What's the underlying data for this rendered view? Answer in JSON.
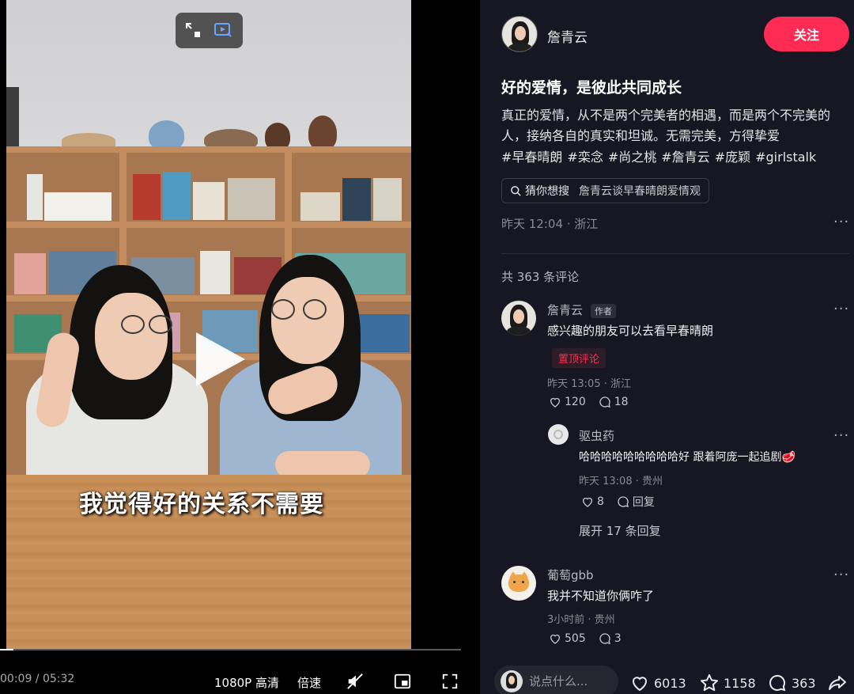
{
  "video": {
    "subtitle": "我觉得好的关系不需要",
    "time": "00:09 / 05:32",
    "progress": 0.03,
    "quality_label": "1080P 高清",
    "speed_label": "倍速"
  },
  "author": {
    "name": "詹青云",
    "follow_label": "关注"
  },
  "post": {
    "title": "好的爱情，是彼此共同成长",
    "description": "真正的爱情，从不是两个完美者的相遇，而是两个不完美的人，接纳各自的真实和坦诚。无需完美，方得挚爱",
    "hashtags": [
      "#早春晴朗",
      "#栾念",
      "#尚之桃",
      "#詹青云",
      "#庞颖",
      "#girlstalk"
    ],
    "guess_label": "猜你想搜",
    "guess_query": "詹青云谈早春晴朗爱情观",
    "meta": "昨天 12:04 · 浙江"
  },
  "comments": {
    "count_label": "共 363 条评论",
    "items": [
      {
        "name": "詹青云",
        "tag": "作者",
        "text": "感兴趣的朋友可以去看早春晴朗",
        "badge": "置顶评论",
        "meta": "昨天 13:05 · 浙江",
        "likes": "120",
        "replies": "18"
      },
      {
        "name": "驱虫药",
        "text": "哈哈哈哈哈哈哈哈哈好 跟着阿庞一起追剧🥩",
        "meta": "昨天 13:08 · 贵州",
        "likes": "8",
        "reply_label": "回复",
        "expand_label": "展开 17 条回复"
      },
      {
        "name": "葡萄gbb",
        "text": "我并不知道你俩咋了",
        "meta": "3小时前 · 贵州",
        "likes": "505",
        "replies": "3"
      }
    ]
  },
  "bottom": {
    "input_placeholder": "说点什么...",
    "likes": "6013",
    "favorites": "1158",
    "comments": "363"
  },
  "colors": {
    "accent": "#fe2c55",
    "panel_bg": "#161722",
    "video_bg": "#000000"
  }
}
